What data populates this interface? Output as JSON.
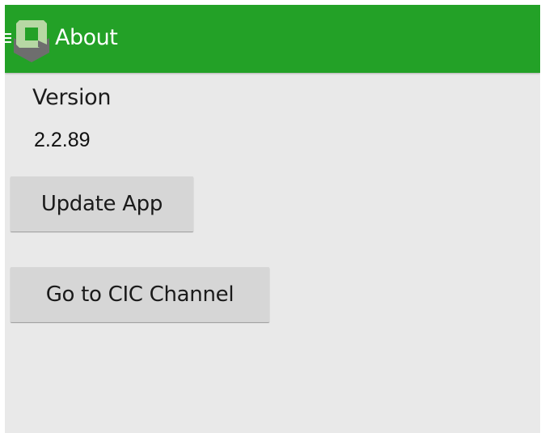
{
  "colors": {
    "action_bar": "#23a127",
    "background": "#e9e9e9",
    "button": "#d6d6d6",
    "logo_light": "#b7d8a4",
    "logo_dark": "#6e6e6e"
  },
  "action_bar": {
    "title": "About",
    "drawer_icon": "hamburger-menu-icon",
    "logo_icon": "app-logo-icon"
  },
  "content": {
    "version_label": "Version",
    "version_value": "2.2.89",
    "update_button_label": "Update App",
    "channel_button_label": "Go to CIC Channel"
  }
}
